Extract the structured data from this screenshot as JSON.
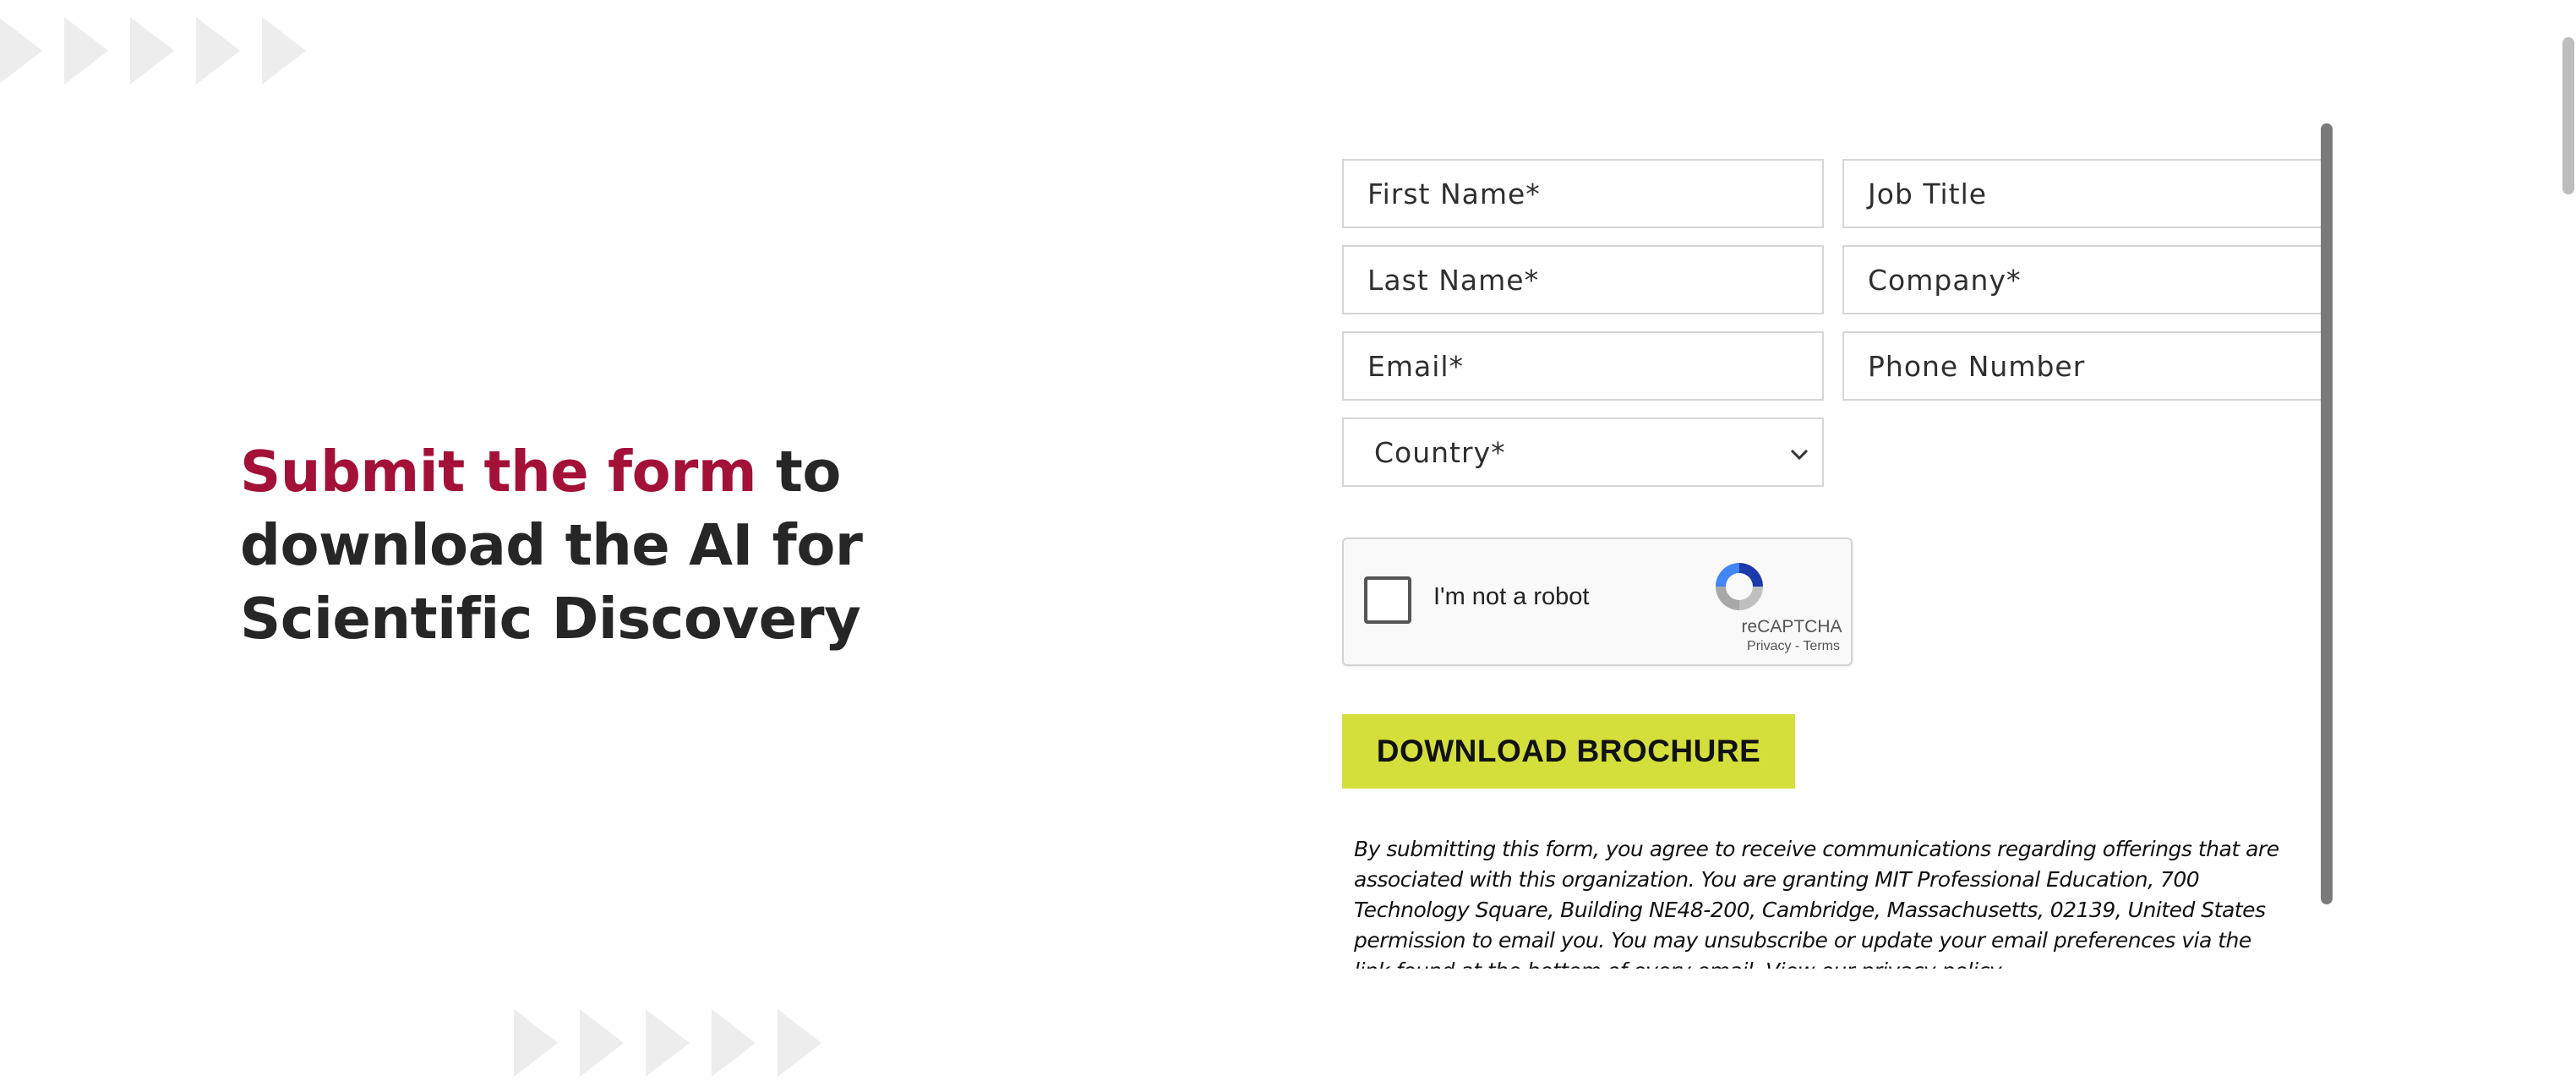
{
  "headline": {
    "accent": "Submit the form",
    "rest": " to download the AI for Scientific Discovery"
  },
  "form": {
    "fields": {
      "first_name": "First Name*",
      "job_title": "Job Title",
      "last_name": "Last Name*",
      "company": "Company*",
      "email": "Email*",
      "phone": "Phone Number"
    },
    "country": {
      "selected": "Country*",
      "caret_icon": "chevron-down-icon"
    },
    "captcha": {
      "label": "I'm not a robot",
      "brand": "reCAPTCHA",
      "links": "Privacy - Terms"
    },
    "submit_label": "DOWNLOAD BROCHURE",
    "disclaimer": "By submitting this form, you agree to receive communications regarding offerings that are associated with this organization. You are granting MIT Professional Education, 700 Technology Square, Building NE48-200, Cambridge, Massachusetts, 02139, United States permission to email you. You may unsubscribe or update your email preferences via the link found at the bottom of every email. View our privacy policy."
  },
  "colors": {
    "accent": "#a31038",
    "button": "#d4df3b",
    "headline_text": "#262626"
  }
}
